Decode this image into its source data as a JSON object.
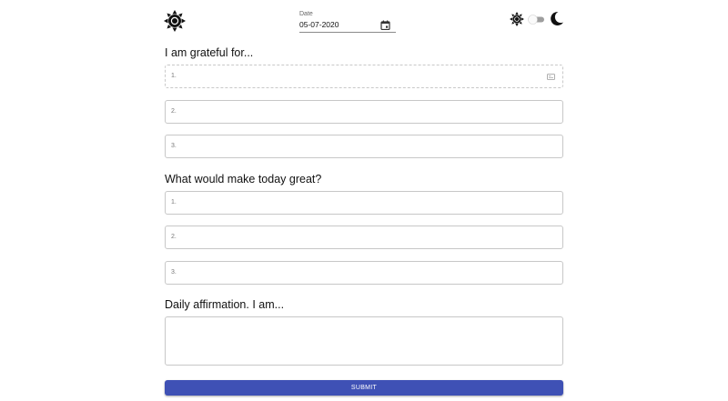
{
  "header": {
    "logo_icon": "sun-icon",
    "date_label": "Date",
    "date_value": "05-07-2020",
    "calendar_icon": "calendar-icon",
    "theme_light_icon": "sun-icon",
    "theme_toggle_icon": "toggle-icon",
    "theme_dark_icon": "moon-icon"
  },
  "grateful": {
    "title": "I am grateful for...",
    "fields": [
      {
        "placeholder": "1."
      },
      {
        "placeholder": "2."
      },
      {
        "placeholder": "3."
      }
    ]
  },
  "great": {
    "title": "What would make today great?",
    "fields": [
      {
        "placeholder": "1."
      },
      {
        "placeholder": "2."
      },
      {
        "placeholder": "3."
      }
    ]
  },
  "affirmation": {
    "title": "Daily affirmation. I am..."
  },
  "submit_label": "SUBMIT",
  "colors": {
    "accent": "#3f51b5",
    "border": "#c7c7c7"
  }
}
